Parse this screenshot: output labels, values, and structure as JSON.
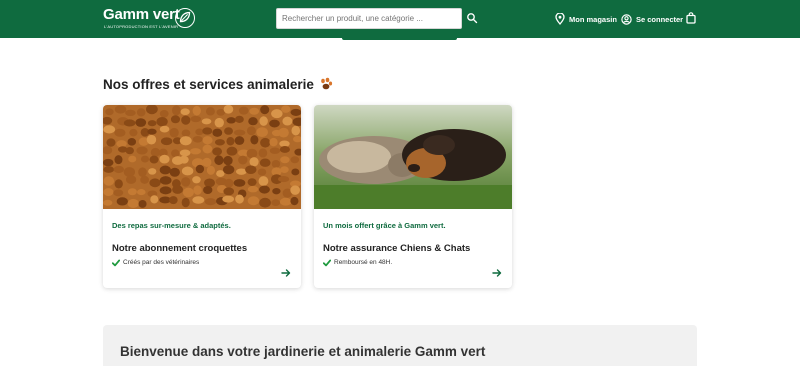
{
  "header": {
    "logo_text": "Gamm vert",
    "logo_tagline": "L'AUTOPRODUCTION EST L'AVENIR",
    "search_placeholder": "Rechercher un produit, une catégorie ...",
    "store_label": "Mon magasin",
    "login_label": "Se connecter"
  },
  "offers": {
    "title": "Nos offres et services animalerie",
    "cards": [
      {
        "kicker": "Des repas sur-mesure & adaptés.",
        "title": "Notre abonnement croquettes",
        "bullet": "Créés par des vétérinaires"
      },
      {
        "kicker": "Un mois offert grâce à Gamm vert.",
        "title": "Notre assurance Chiens & Chats",
        "bullet": "Remboursé en 48H."
      }
    ]
  },
  "welcome": {
    "title": "Bienvenue dans votre jardinerie et animalerie Gamm vert"
  },
  "colors": {
    "brand_green": "#0f6b3f",
    "check_green": "#1f9a3f"
  },
  "icons": [
    "search-icon",
    "location-pin-icon",
    "user-icon",
    "bag-icon",
    "paw-icon",
    "check-icon",
    "arrow-right-icon"
  ]
}
